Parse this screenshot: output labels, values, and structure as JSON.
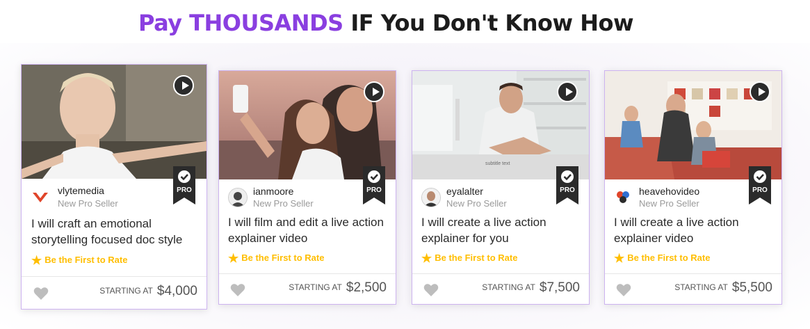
{
  "headline": {
    "accent": "Pay THOUSANDS",
    "rest": "IF You Don't Know How"
  },
  "colors": {
    "accent": "#8a3fe0",
    "card_border": "#cdb3f0",
    "rating": "#ffbe00",
    "price": "#555555"
  },
  "cards": [
    {
      "seller": "vlytemedia",
      "level": "New Pro Seller",
      "title": "I will craft an emotional storytelling focused doc style",
      "rating": "Be the First to Rate",
      "starting": "STARTING AT",
      "price": "$4,000",
      "badge": "PRO"
    },
    {
      "seller": "ianmoore",
      "level": "New Pro Seller",
      "title": "I will film and edit a live action explainer video",
      "rating": "Be the First to Rate",
      "starting": "STARTING AT",
      "price": "$2,500",
      "badge": "PRO"
    },
    {
      "seller": "eyalalter",
      "level": "New Pro Seller",
      "title": "I will create a live action explainer for you",
      "rating": "Be the First to Rate",
      "starting": "STARTING AT",
      "price": "$7,500",
      "badge": "PRO"
    },
    {
      "seller": "heavehovideo",
      "level": "New Pro Seller",
      "title": "I will create a live action explainer video",
      "rating": "Be the First to Rate",
      "starting": "STARTING AT",
      "price": "$5,500",
      "badge": "PRO"
    }
  ],
  "icons": {
    "play": "play-icon",
    "pro_badge": "pro-badge-icon",
    "star": "star-icon",
    "heart": "heart-icon"
  }
}
